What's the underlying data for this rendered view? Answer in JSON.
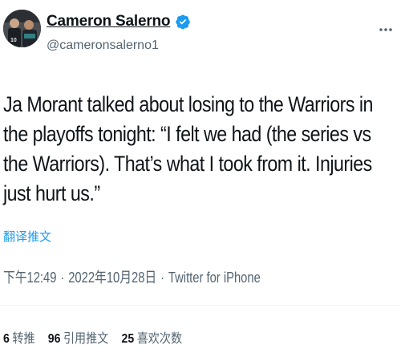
{
  "author": {
    "display_name": "Cameron Salerno",
    "handle": "@cameronsalerno1",
    "avatar_jersey_number": "10"
  },
  "tweet": {
    "text": "Ja Morant talked about losing to the Warriors in the playoffs tonight: “I felt we had (the series vs the Warriors). That’s what I took from it. Injuries just hurt us.”",
    "translate_label": "翻译推文",
    "time": "下午12:49",
    "date": "2022年10月28日",
    "source": "Twitter for iPhone",
    "separator": "·"
  },
  "stats": {
    "retweets": {
      "count": "6",
      "label": "转推"
    },
    "quotes": {
      "count": "96",
      "label": "引用推文"
    },
    "likes": {
      "count": "25",
      "label": "喜欢次数"
    }
  },
  "colors": {
    "link": "#1d9bf0",
    "secondary_text": "#536471",
    "primary_text": "#0f1419",
    "verified_badge": "#1d9bf0"
  },
  "icons": {
    "verified": "verified-badge-icon",
    "more": "more-options-icon"
  }
}
